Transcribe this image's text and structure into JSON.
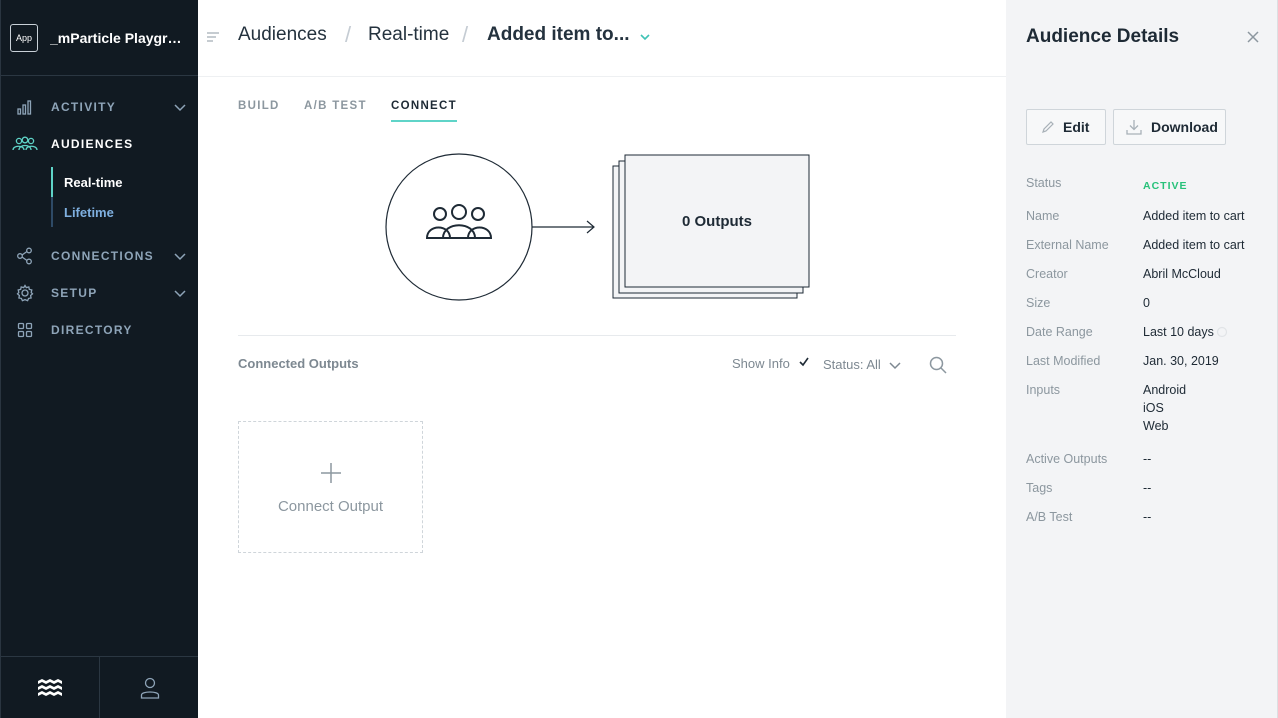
{
  "app": {
    "badge": "App",
    "name": "_mParticle Playground"
  },
  "nav": {
    "activity": "ACTIVITY",
    "audiences": "AUDIENCES",
    "sub_realtime": "Real-time",
    "sub_lifetime": "Lifetime",
    "connections": "CONNECTIONS",
    "setup": "SETUP",
    "directory": "DIRECTORY"
  },
  "breadcrumb": {
    "item1": "Audiences",
    "item2": "Real-time",
    "current": "Added item to..."
  },
  "tabs": {
    "build": "BUILD",
    "ab_test": "A/B TEST",
    "connect": "CONNECT"
  },
  "diagram": {
    "outputs_label": "0 Outputs"
  },
  "outputs": {
    "title": "Connected Outputs",
    "show_info": "Show Info",
    "status_filter": "Status: All",
    "connect_label": "Connect Output"
  },
  "panel": {
    "title": "Audience Details",
    "edit_label": "Edit",
    "download_label": "Download",
    "details": [
      {
        "key": "Status",
        "value": "ACTIVE"
      },
      {
        "key": "Name",
        "value": "Added item to cart"
      },
      {
        "key": "External Name",
        "value": "Added item to cart"
      },
      {
        "key": "Creator",
        "value": "Abril McCloud"
      },
      {
        "key": "Size",
        "value": "0"
      },
      {
        "key": "Date Range",
        "value": "Last 10 days"
      },
      {
        "key": "Last Modified",
        "value": "Jan. 30, 2019"
      },
      {
        "key": "Inputs",
        "values": [
          "Android",
          "iOS",
          "Web"
        ]
      },
      {
        "key": "Active Outputs",
        "value": "--"
      },
      {
        "key": "Tags",
        "value": "--"
      },
      {
        "key": "A/B Test",
        "value": "--"
      }
    ]
  },
  "colors": {
    "accent": "#5fd4c8",
    "sidebar_bg": "#111a22",
    "status_active": "#27c17a"
  }
}
